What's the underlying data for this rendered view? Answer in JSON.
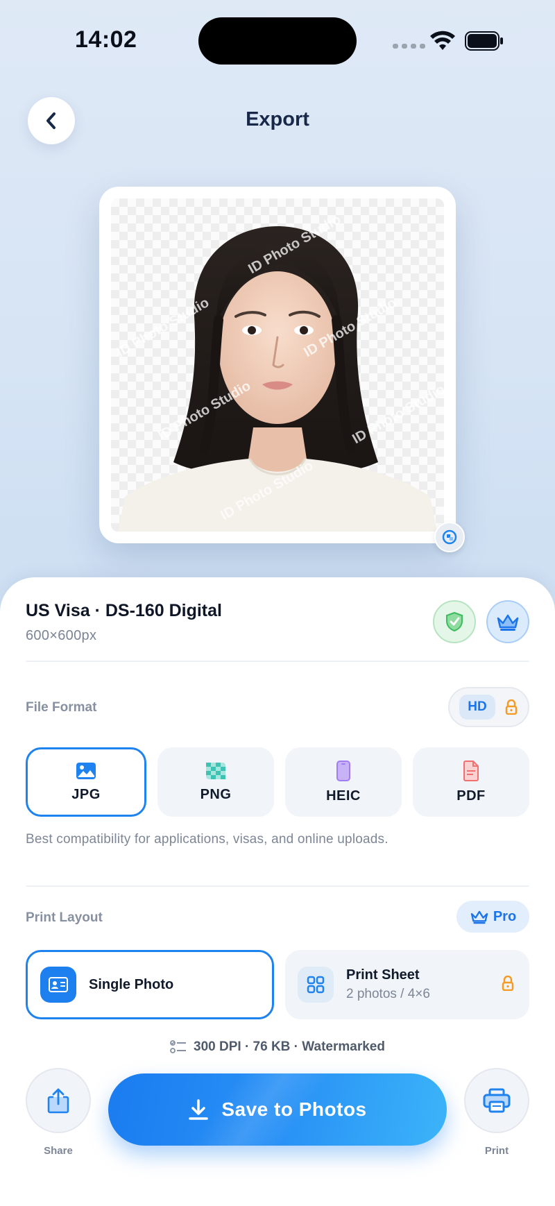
{
  "status_bar": {
    "time": "14:02"
  },
  "header": {
    "title": "Export"
  },
  "preview": {
    "watermark_text": "ID Photo Studio"
  },
  "document": {
    "title": "US Visa · DS-160 Digital",
    "size": "600×600px"
  },
  "file_format": {
    "label": "File Format",
    "hd_label": "HD",
    "options": [
      {
        "label": "JPG",
        "icon": "image-icon",
        "color": "#1e82ef",
        "active": true
      },
      {
        "label": "PNG",
        "icon": "checker-icon",
        "color": "#3cc3b4",
        "active": false
      },
      {
        "label": "HEIC",
        "icon": "phone-icon",
        "color": "#a27cf2",
        "active": false
      },
      {
        "label": "PDF",
        "icon": "document-icon",
        "color": "#f07070",
        "active": false
      }
    ],
    "description": "Best compatibility for applications, visas, and online uploads."
  },
  "print_layout": {
    "label": "Print Layout",
    "pro_label": "Pro",
    "options": [
      {
        "title": "Single Photo",
        "subtitle": "",
        "active": true
      },
      {
        "title": "Print Sheet",
        "subtitle": "2 photos / 4×6",
        "active": false,
        "locked": true
      }
    ]
  },
  "meta": {
    "text": "300 DPI · 76 KB · Watermarked"
  },
  "actions": {
    "share_label": "Share",
    "save_label": "Save to Photos",
    "print_label": "Print"
  },
  "colors": {
    "accent": "#1e82ef",
    "lock": "#f59a23",
    "success": "#3dbb5f"
  }
}
